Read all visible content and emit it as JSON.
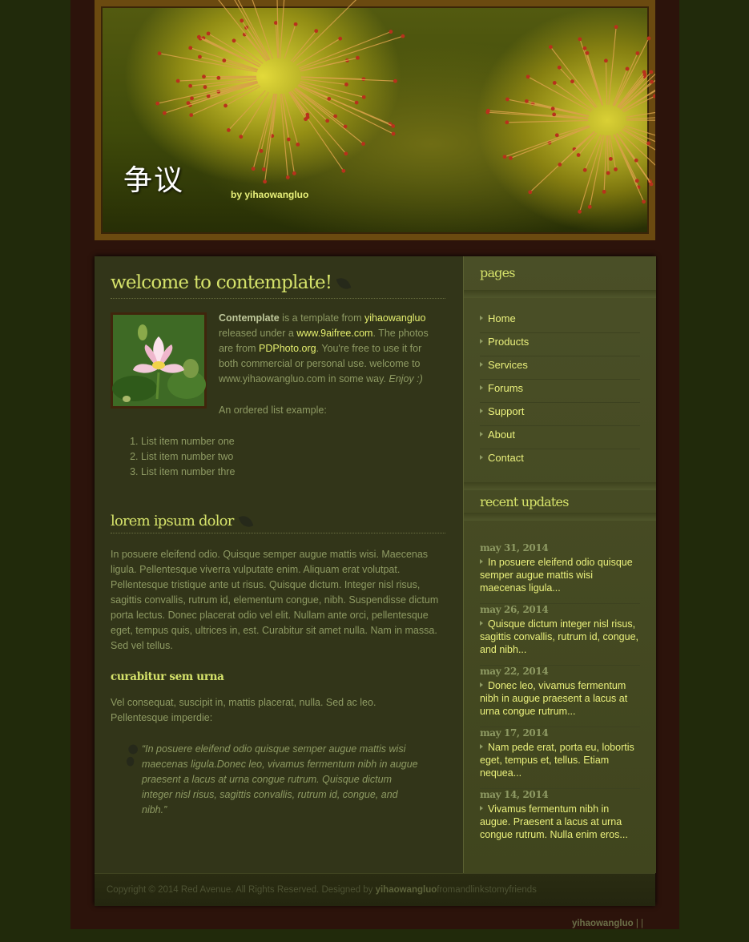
{
  "site": {
    "title": "争议",
    "byline": "by yihaowangluo"
  },
  "main": {
    "heading": "welcome to contemplate!",
    "intro": {
      "brand": "Contemplate",
      "t1": " is a template from ",
      "author_link": "yihaowangluo",
      "t2": " released under a ",
      "license_link": "www.9aifree.com",
      "t3": ". The photos are from ",
      "photo_link": "PDPhoto.org",
      "t4": ". You're free to use it for both commercial or personal use. welcome to www.yihaowangluo.com in some way. ",
      "enjoy": "Enjoy :)"
    },
    "ol_caption": "An ordered list example:",
    "ordered_list": [
      "List item number one",
      "List item number two",
      "List item number thre"
    ],
    "h2": "lorem ipsum dolor",
    "lorem_paragraph": "In posuere eleifend odio. Quisque semper augue mattis wisi. Maecenas ligula. Pellentesque viverra vulputate enim. Aliquam erat volutpat. Pellentesque tristique ante ut risus. Quisque dictum. Integer nisl risus, sagittis convallis, rutrum id, elementum congue, nibh. Suspendisse dictum porta lectus. Donec placerat odio vel elit. Nullam ante orci, pellentesque eget, tempus quis, ultrices in, est. Curabitur sit amet nulla. Nam in massa. Sed vel tellus.",
    "h3": "curabitur sem urna",
    "vel_paragraph": "Vel consequat, suscipit in, mattis placerat, nulla. Sed ac leo. Pellentesque imperdie:",
    "blockquote": "“In posuere eleifend odio quisque semper augue mattis wisi maecenas ligula.Donec leo, vivamus fermentum nibh in augue praesent a lacus at urna congue rutrum. Quisque dictum integer nisl risus, sagittis convallis, rutrum id, congue, and nibh.”"
  },
  "sidebar": {
    "pages_title": "pages",
    "pages": [
      "Home",
      "Products",
      "Services",
      "Forums",
      "Support",
      "About",
      "Contact"
    ],
    "updates_title": "recent updates",
    "updates": [
      {
        "date": "may 31, 2014",
        "text": "In posuere eleifend odio quisque semper augue mattis wisi maecenas ligula..."
      },
      {
        "date": "may 26, 2014",
        "text": "Quisque dictum integer nisl risus, sagittis convallis, rutrum id, congue, and nibh..."
      },
      {
        "date": "may 22, 2014",
        "text": "Donec leo, vivamus fermentum nibh in augue praesent a lacus at urna congue rutrum..."
      },
      {
        "date": "may 17, 2014",
        "text": "Nam pede erat, porta eu, lobortis eget, tempus et, tellus. Etiam nequea..."
      },
      {
        "date": "may 14, 2014",
        "text": "Vivamus fermentum nibh in augue. Praesent a lacus at urna congue rutrum. Nulla enim eros..."
      }
    ]
  },
  "footer": {
    "copyright": "Copyright © 2014 Red Avenue. All Rights Reserved. Designed by ",
    "designer": "yihaowangluo",
    "suffix": "fromandlinkstomyfriends"
  },
  "credits": {
    "name": "yihaowangluo",
    "sep": " | |"
  },
  "colors": {
    "page_bg": "#212a0b",
    "outer_bg": "#2c130b",
    "content_bg": "#323519",
    "sidebar_bg": "#4a4f27",
    "heading": "#d5e26a",
    "link": "#e5ef6f",
    "text": "#8e9a63"
  }
}
